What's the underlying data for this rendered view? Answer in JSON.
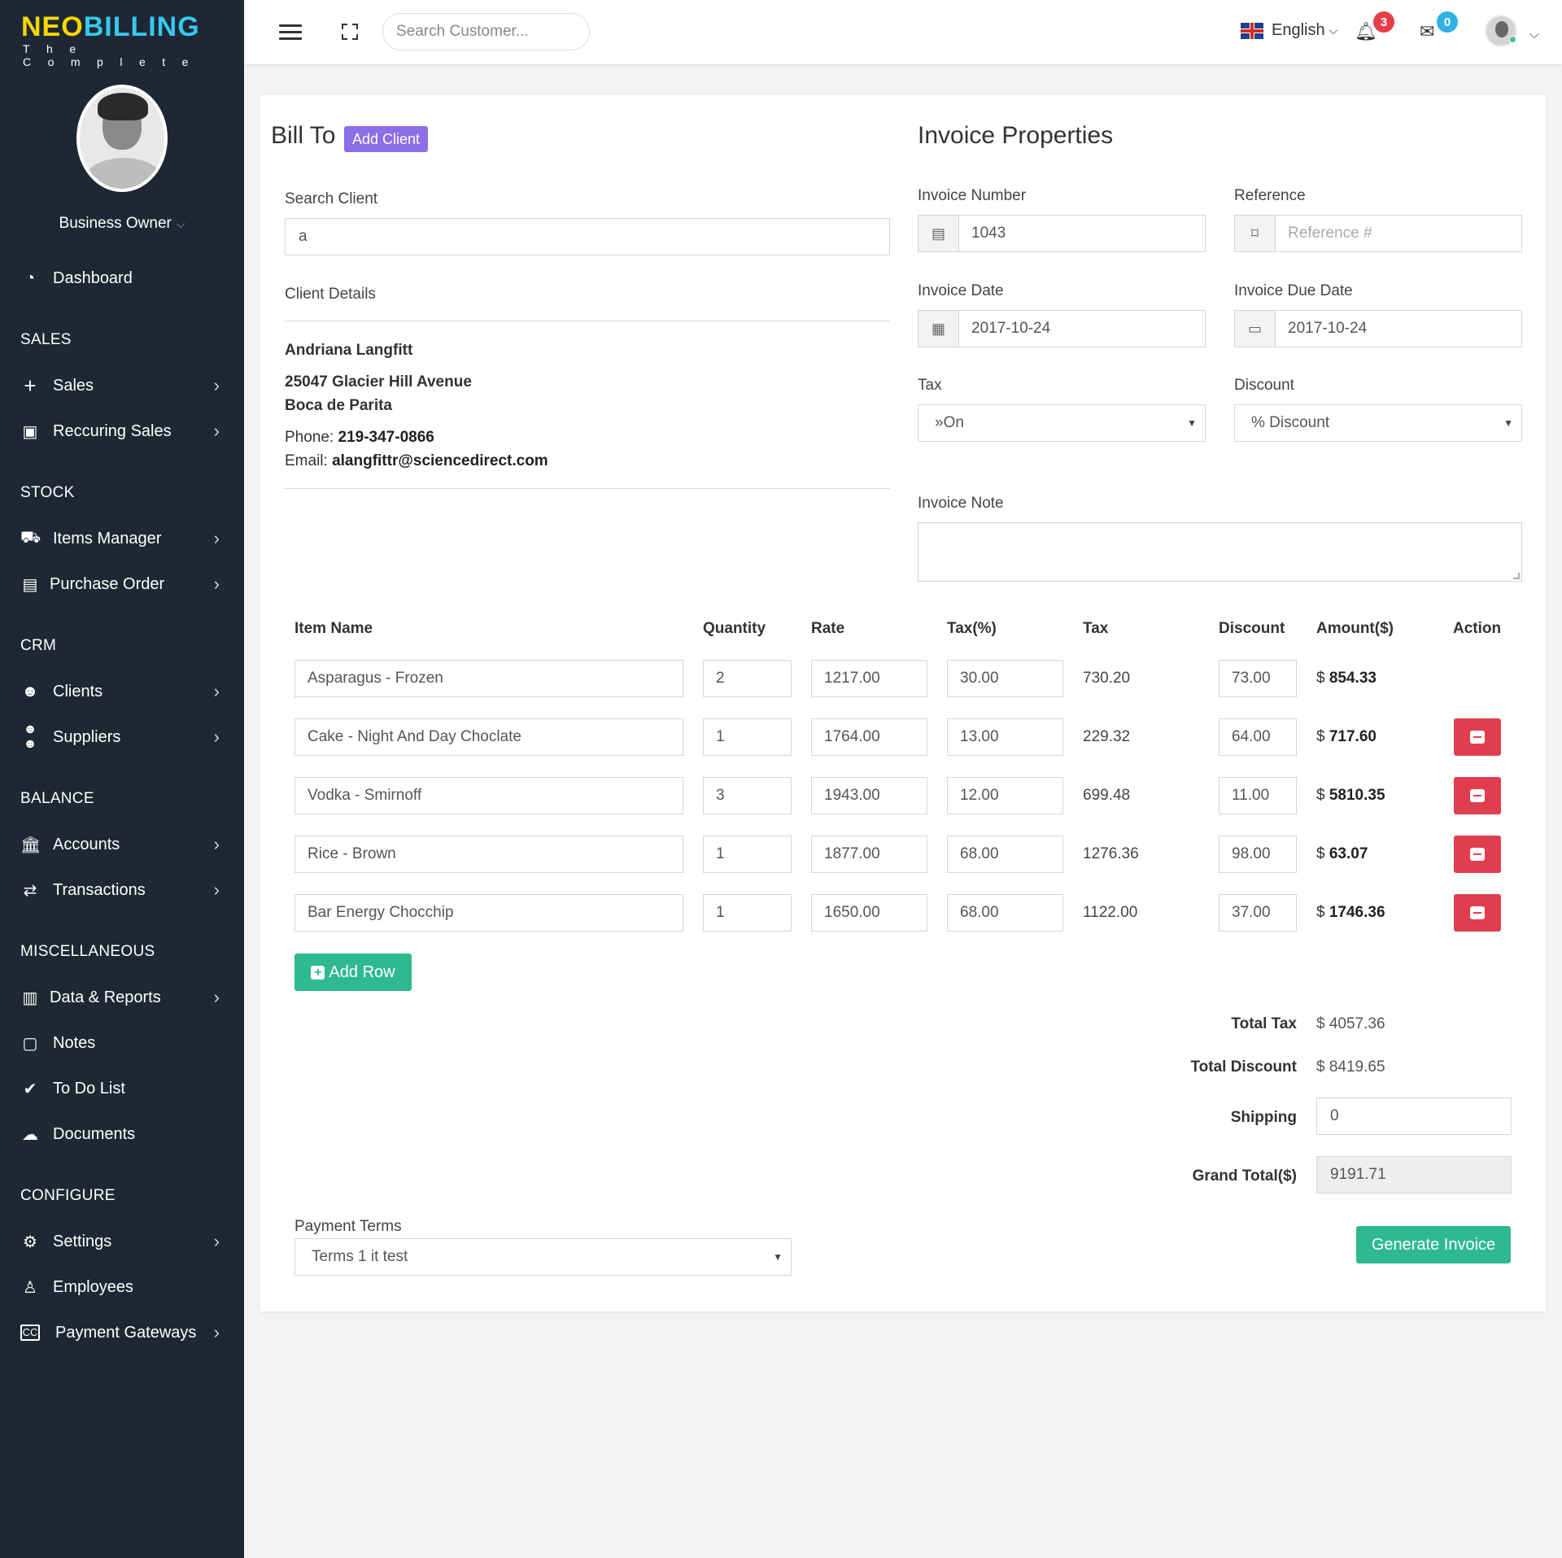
{
  "brand": {
    "name_part1": "NEO",
    "name_part2": "BILLING",
    "tagline": "The Complete"
  },
  "profile": {
    "name": "Business Owner"
  },
  "sidebar": {
    "dashboard": "Dashboard",
    "sections": {
      "sales": "SALES",
      "stock": "STOCK",
      "crm": "CRM",
      "balance": "BALANCE",
      "misc": "MISCELLANEOUS",
      "configure": "CONFIGURE"
    },
    "items": {
      "sales": "Sales",
      "recurring_sales": "Reccuring Sales",
      "items_manager": "Items Manager",
      "purchase_order": "Purchase Order",
      "clients": "Clients",
      "suppliers": "Suppliers",
      "accounts": "Accounts",
      "transactions": "Transactions",
      "data_reports": "Data & Reports",
      "notes": "Notes",
      "todo": "To Do List",
      "documents": "Documents",
      "settings": "Settings",
      "employees": "Employees",
      "payment_gateways": "Payment Gateways"
    }
  },
  "topbar": {
    "search_placeholder": "Search Customer...",
    "language": "English",
    "notifications_count": "3",
    "messages_count": "0"
  },
  "bill_to": {
    "title": "Bill To",
    "add_client": "Add Client",
    "search_label": "Search Client",
    "search_value": "a",
    "details_label": "Client Details",
    "client_name": "Andriana Langfitt",
    "address1": "25047 Glacier Hill Avenue",
    "address2": "Boca de Parita",
    "phone_label": "Phone:",
    "phone": "219-347-0866",
    "email_label": "Email:",
    "email": "alangfittr@sciencedirect.com"
  },
  "invoice": {
    "title": "Invoice Properties",
    "number_label": "Invoice Number",
    "number": "1043",
    "reference_label": "Reference",
    "reference_placeholder": "Reference #",
    "date_label": "Invoice Date",
    "date": "2017-10-24",
    "due_label": "Invoice Due Date",
    "due": "2017-10-24",
    "tax_label": "Tax",
    "tax_value": "»On",
    "discount_label": "Discount",
    "discount_value": "% Discount",
    "note_label": "Invoice Note"
  },
  "table": {
    "headers": [
      "Item Name",
      "Quantity",
      "Rate",
      "Tax(%)",
      "Tax",
      "Discount",
      "Amount($)",
      "Action"
    ],
    "currency": "$",
    "rows": [
      {
        "name": "Asparagus - Frozen",
        "qty": "2",
        "rate": "1217.00",
        "tax_pct": "30.00",
        "tax": "730.20",
        "discount": "73.00",
        "amount": "854.33"
      },
      {
        "name": "Cake - Night And Day Choclate",
        "qty": "1",
        "rate": "1764.00",
        "tax_pct": "13.00",
        "tax": "229.32",
        "discount": "64.00",
        "amount": "717.60"
      },
      {
        "name": "Vodka - Smirnoff",
        "qty": "3",
        "rate": "1943.00",
        "tax_pct": "12.00",
        "tax": "699.48",
        "discount": "11.00",
        "amount": "5810.35"
      },
      {
        "name": "Rice - Brown",
        "qty": "1",
        "rate": "1877.00",
        "tax_pct": "68.00",
        "tax": "1276.36",
        "discount": "98.00",
        "amount": "63.07"
      },
      {
        "name": "Bar Energy Chocchip",
        "qty": "1",
        "rate": "1650.00",
        "tax_pct": "68.00",
        "tax": "1122.00",
        "discount": "37.00",
        "amount": "1746.36"
      }
    ],
    "add_row": "Add Row"
  },
  "summary": {
    "total_tax_label": "Total Tax",
    "total_tax": "$ 4057.36",
    "total_discount_label": "Total Discount",
    "total_discount": "$ 8419.65",
    "shipping_label": "Shipping",
    "shipping": "0",
    "grand_total_label": "Grand Total($)",
    "grand_total": "9191.71"
  },
  "payment": {
    "label": "Payment Terms",
    "value": "Terms 1 it test"
  },
  "generate_button": "Generate Invoice",
  "colors": {
    "sidebar_bg": "#1e2834",
    "accent_green": "#2fb98f",
    "danger": "#e03e4f",
    "purple": "#8d6ee8"
  }
}
